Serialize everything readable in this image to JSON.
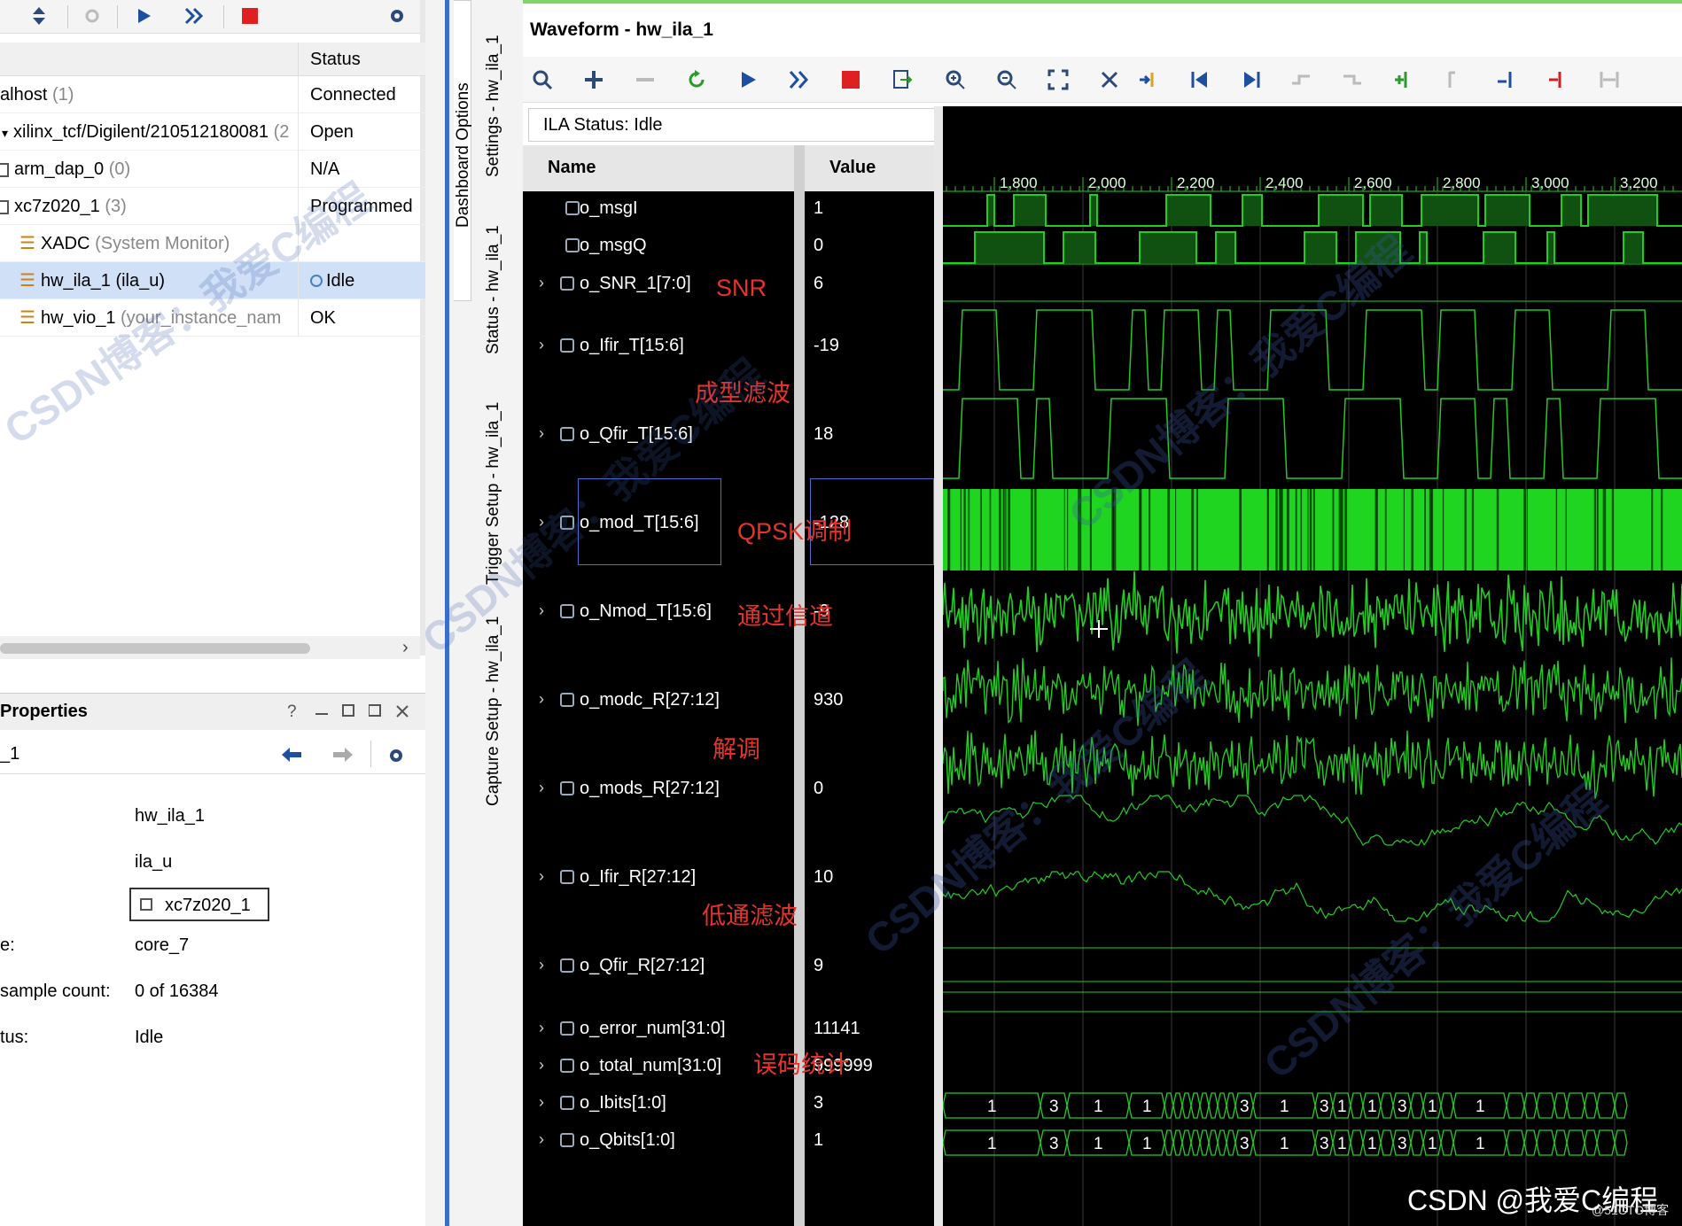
{
  "left_panel": {
    "table_header": {
      "status": "Status"
    },
    "rows": [
      {
        "name": "alhost",
        "count": "(1)",
        "status": "Connected"
      },
      {
        "name": "xilinx_tcf/Digilent/210512180081",
        "count": "(2",
        "status": "Open"
      },
      {
        "name": "arm_dap_0",
        "count": "(0)",
        "status": "N/A"
      },
      {
        "name": "xc7z020_1",
        "count": "(3)",
        "status": "Programmed"
      },
      {
        "name": "XADC",
        "count": "(System Monitor)",
        "status": ""
      },
      {
        "name": "hw_ila_1 (ila_u)",
        "count": "",
        "status": "Idle"
      },
      {
        "name": "hw_vio_1",
        "count": "(your_instance_nam",
        "status": "OK"
      }
    ],
    "properties": {
      "title": "Properties",
      "help": "?",
      "object": "_1",
      "fields": [
        {
          "label": "",
          "value": "hw_ila_1"
        },
        {
          "label": "",
          "value": "ila_u"
        },
        {
          "label": "",
          "value": "xc7z020_1"
        },
        {
          "label": "e:",
          "value": "core_7"
        },
        {
          "label": "sample count:",
          "value": "0 of 16384"
        },
        {
          "label": "tus:",
          "value": "Idle"
        }
      ]
    }
  },
  "tabs": {
    "dashboard": "Dashboard Options",
    "settings": "Settings - hw_ila_1",
    "status": "Status - hw_ila_1",
    "trigger": "Trigger Setup - hw_ila_1",
    "capture": "Capture Setup - hw_ila_1"
  },
  "waveform": {
    "title": "Waveform - hw_ila_1",
    "ila_status_label": "ILA Status:",
    "ila_status": "Idle",
    "name_header": "Name",
    "value_header": "Value",
    "ruler_ticks": [
      "1,800",
      "2,000",
      "2,200",
      "2,400",
      "2,600",
      "2,800",
      "3,000",
      "3,200"
    ],
    "signals": [
      {
        "name": "o_msgI",
        "value": "1"
      },
      {
        "name": "o_msgQ",
        "value": "0"
      },
      {
        "name": "o_SNR_1[7:0]",
        "value": "6"
      },
      {
        "name": "o_Ifir_T[15:6]",
        "value": "-19"
      },
      {
        "name": "o_Qfir_T[15:6]",
        "value": "18"
      },
      {
        "name": "o_mod_T[15:6]",
        "value": "-128"
      },
      {
        "name": "o_Nmod_T[15:6]",
        "value": "-9"
      },
      {
        "name": "o_modc_R[27:12]",
        "value": "930"
      },
      {
        "name": "o_mods_R[27:12]",
        "value": "0"
      },
      {
        "name": "o_Ifir_R[27:12]",
        "value": "10"
      },
      {
        "name": "o_Qfir_R[27:12]",
        "value": "9"
      },
      {
        "name": "o_error_num[31:0]",
        "value": "11141"
      },
      {
        "name": "o_total_num[31:0]",
        "value": "999999"
      },
      {
        "name": "o_Ibits[1:0]",
        "value": "3"
      },
      {
        "name": "o_Qbits[1:0]",
        "value": "1"
      }
    ],
    "bus_labels_I": [
      "1",
      "3",
      "1",
      "1",
      "3",
      "1",
      "3",
      "1",
      "1",
      "3",
      "1",
      "1"
    ],
    "bus_labels_Q": [
      "1",
      "3",
      "1",
      "1",
      "3",
      "1",
      "3",
      "1",
      "1",
      "3",
      "1",
      "1"
    ]
  },
  "annotations": {
    "snr": "SNR",
    "shaping": "成型滤波",
    "qpsk": "QPSK调制",
    "channel": "通过信道",
    "demod": "解调",
    "lowpass": "低通滤波",
    "ber": "误码统计"
  },
  "watermarks": {
    "blog": "CSDN博客：我爱C编程",
    "footer": "CSDN @我爱C编程",
    "small": "@51CTO博客"
  },
  "colors": {
    "wave_green": "#22cc22",
    "bus_green": "#1fd51f",
    "annotation_red": "#e8322a",
    "stop_red": "#e02020",
    "selection": "#cfe0f7"
  }
}
